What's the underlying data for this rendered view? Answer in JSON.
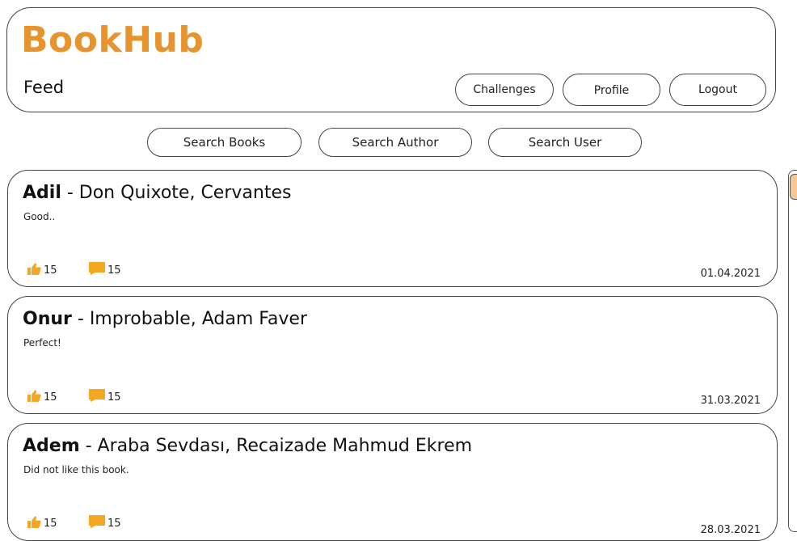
{
  "app": {
    "title": "BookHub",
    "page": "Feed"
  },
  "nav": {
    "challenges_label": "Challenges",
    "profile_label": "Profile",
    "logout_label": "Logout"
  },
  "search": {
    "books_label": "Search Books",
    "author_label": "Search Author",
    "user_label": "Search User"
  },
  "colors": {
    "brand": "#e8942e",
    "icon": "#f5a623",
    "scroll_thumb": "#f1c99a"
  },
  "icons": {
    "like": "thumbs-up-icon",
    "comment": "comment-icon"
  },
  "posts": [
    {
      "user": "Adil",
      "book": " - Don Quixote, Cervantes",
      "text": "Good..",
      "likes": "15",
      "comments": "15",
      "date": "01.04.2021"
    },
    {
      "user": "Onur",
      "book": " - Improbable, Adam Faver",
      "text": "Perfect!",
      "likes": "15",
      "comments": "15",
      "date": "31.03.2021"
    },
    {
      "user": "Adem",
      "book": " - Araba Sevdası, Recaizade Mahmud Ekrem",
      "text": "Did not like this book.",
      "likes": "15",
      "comments": "15",
      "date": "28.03.2021"
    }
  ]
}
